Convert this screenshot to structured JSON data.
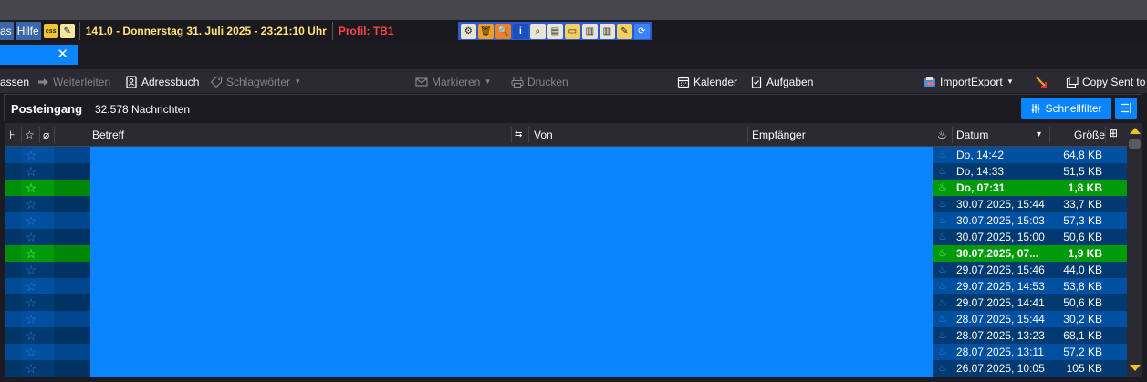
{
  "menubar": {
    "menu_items": [
      "as",
      "Hilfe"
    ],
    "version_clock": "141.0 - Donnerstag 31. Juli 2025 - 23:21:10 Uhr",
    "profile": "Profil:  TB1",
    "icon_names": [
      "gear-icon",
      "trash-icon",
      "search-icon",
      "info-icon",
      "find-icon",
      "document-icon",
      "folder-icon",
      "notebook-icon",
      "notebook-alt-icon",
      "folder-edit-icon",
      "refresh-icon"
    ]
  },
  "tab": {
    "close": "✕"
  },
  "toolbar": {
    "verfassen": "assen",
    "weiterleiten": "Weiterleiten",
    "adressbuch": "Adressbuch",
    "schlagwoerter": "Schlagwörter",
    "markieren": "Markieren",
    "drucken": "Drucken",
    "kalender": "Kalender",
    "aufgaben": "Aufgaben",
    "importexport": "ImportExport",
    "copysent": "Copy Sent to"
  },
  "folder": {
    "name": "Posteingang",
    "count": "32.578 Nachrichten",
    "quickfilter": "Schnellfilter"
  },
  "columns": {
    "betreff": "Betreff",
    "von": "Von",
    "empfaenger": "Empfänger",
    "datum": "Datum",
    "groesse": "Größe"
  },
  "messages": [
    {
      "date": "Do, 14:42",
      "size": "64,8 KB",
      "unread": false
    },
    {
      "date": "Do, 14:33",
      "size": "51,5 KB",
      "unread": false
    },
    {
      "date": "Do, 07:31",
      "size": "1,8 KB",
      "unread": true
    },
    {
      "date": "30.07.2025, 15:44",
      "size": "33,7 KB",
      "unread": false
    },
    {
      "date": "30.07.2025, 15:03",
      "size": "57,3 KB",
      "unread": false
    },
    {
      "date": "30.07.2025, 15:00",
      "size": "50,6 KB",
      "unread": false
    },
    {
      "date": "30.07.2025, 07...",
      "size": "1,9 KB",
      "unread": true
    },
    {
      "date": "29.07.2025, 15:46",
      "size": "44,0 KB",
      "unread": false
    },
    {
      "date": "29.07.2025, 14:53",
      "size": "53,8 KB",
      "unread": false
    },
    {
      "date": "29.07.2025, 14:41",
      "size": "50,6 KB",
      "unread": false
    },
    {
      "date": "28.07.2025, 15:44",
      "size": "30,2 KB",
      "unread": false
    },
    {
      "date": "28.07.2025, 13:23",
      "size": "68,1 KB",
      "unread": false
    },
    {
      "date": "28.07.2025, 13:11",
      "size": "57,2 KB",
      "unread": false
    },
    {
      "date": "26.07.2025, 10:05",
      "size": "105 KB",
      "unread": false
    }
  ],
  "colors": {
    "accent": "#0a84ff",
    "unread_row": "#009a0a",
    "row_dark": "#003a71",
    "row_light": "#0050a2"
  }
}
